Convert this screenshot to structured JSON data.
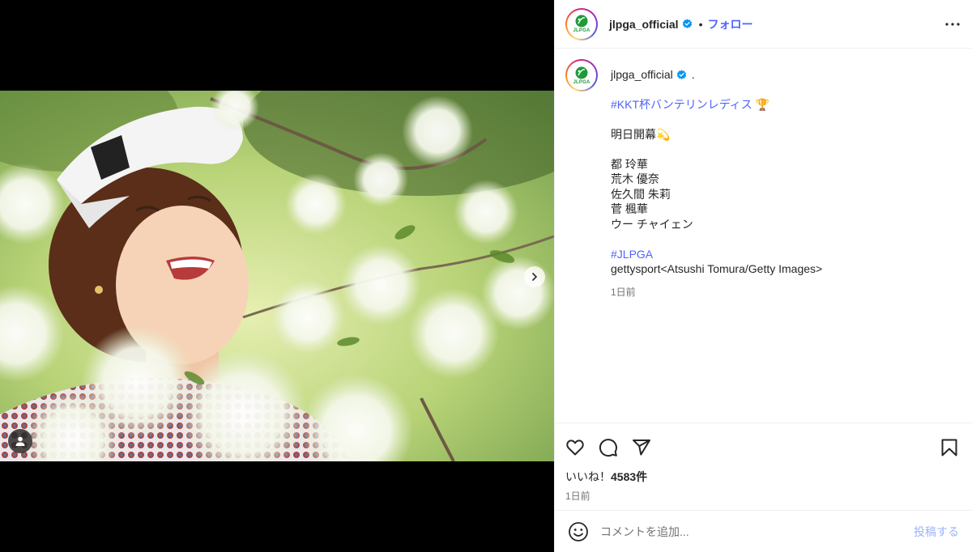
{
  "account": {
    "username": "jlpga_official",
    "logo_text": "JLPGA",
    "separator": "•",
    "follow_label": "フォロー"
  },
  "caption": {
    "trailing": ".",
    "lines": [
      {
        "type": "hashtag",
        "text": "#KKT杯バンテリンレディス 🏆"
      },
      {
        "type": "gap"
      },
      {
        "type": "text",
        "text": "明日開幕💫"
      },
      {
        "type": "gap"
      },
      {
        "type": "text",
        "text": "都 玲華"
      },
      {
        "type": "text",
        "text": "荒木 優奈"
      },
      {
        "type": "text",
        "text": "佐久間 朱莉"
      },
      {
        "type": "text",
        "text": "菅 楓華"
      },
      {
        "type": "text",
        "text": "ウー チャイェン"
      },
      {
        "type": "gap"
      },
      {
        "type": "hashtag",
        "text": "#JLPGA"
      },
      {
        "type": "text",
        "text": "gettysport<Atsushi Tomura/Getty Images>"
      }
    ],
    "time": "1日前"
  },
  "stats": {
    "likes_label": "いいね！",
    "likes_count": "4583件",
    "time": "1日前"
  },
  "comment": {
    "placeholder": "コメントを追加...",
    "post_label": "投稿する"
  },
  "icons": {
    "logo": "jlpga-logo-icon",
    "verified": "verified-badge-icon",
    "more": "more-options-icon",
    "like": "heart-icon",
    "comment": "comment-icon",
    "share": "share-icon",
    "save": "bookmark-icon",
    "emoji": "emoji-icon",
    "next": "chevron-right-icon",
    "tag": "user-tag-icon"
  },
  "colors": {
    "link": "#4e63ff",
    "verified": "#0095f6",
    "brand_green": "#1f9a3a",
    "post_disabled": "#9cb4f5"
  }
}
